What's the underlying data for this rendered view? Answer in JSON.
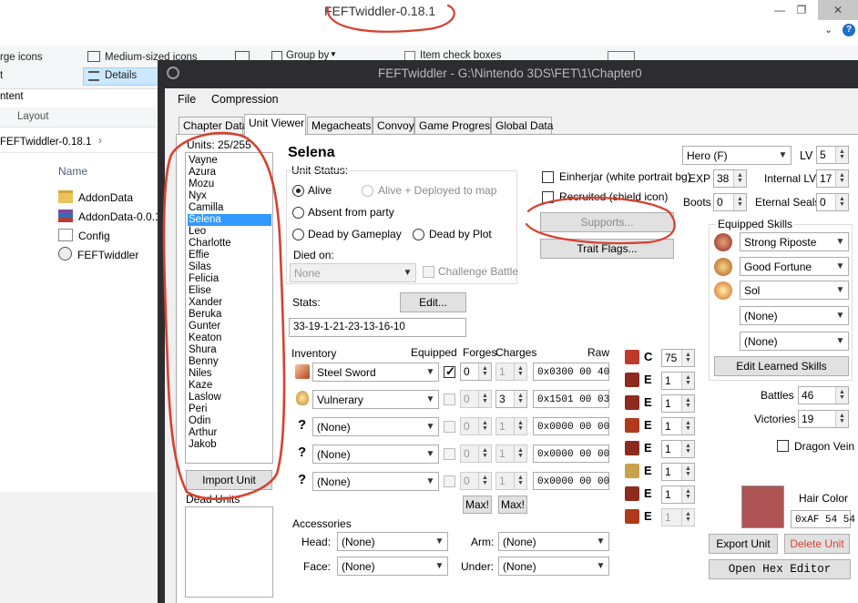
{
  "explorer": {
    "title": "FEFTwiddler-0.18.1",
    "ribbon": {
      "large_icons": "rge icons",
      "medium_icons": "Medium-sized icons",
      "details": "Details",
      "group_by": "Group by",
      "item_check_boxes": "Item check boxes",
      "list_frag": "t",
      "content_frag": "ntent",
      "layout": "Layout"
    },
    "breadcrumb": "FEFTwiddler-0.18.1",
    "column_name": "Name",
    "files": [
      "AddonData",
      "AddonData-0.0.1",
      "Config",
      "FEFTwiddler"
    ]
  },
  "app": {
    "title": "FEFTwiddler - G:\\Nintendo 3DS\\FET\\1\\Chapter0",
    "menu": [
      "File",
      "Compression"
    ],
    "tabs": [
      "Chapter Data",
      "Unit Viewer",
      "Megacheats",
      "Convoy",
      "Game Progress",
      "Global Data"
    ],
    "active_tab": "Unit Viewer",
    "units_label": "Units: 25/255",
    "units": [
      "Vayne",
      "Azura",
      "Mozu",
      "Nyx",
      "Camilla",
      "Selena",
      "Leo",
      "Charlotte",
      "Effie",
      "Silas",
      "Felicia",
      "Elise",
      "Xander",
      "Beruka",
      "Gunter",
      "Keaton",
      "Shura",
      "Benny",
      "Niles",
      "Kaze",
      "Laslow",
      "Peri",
      "Odin",
      "Arthur",
      "Jakob"
    ],
    "selected_unit": "Selena",
    "import_unit": "Import Unit",
    "dead_units": "Dead Units",
    "unit": {
      "name": "Selena",
      "status_label": "Unit Status:",
      "status_options": [
        "Alive",
        "Alive + Deployed to map",
        "Absent from party",
        "Dead by Gameplay",
        "Dead by Plot"
      ],
      "selected_status": "Alive",
      "died_on_label": "Died on:",
      "died_on_value": "None",
      "challenge_battle": "Challenge Battle",
      "stats_label": "Stats:",
      "edit": "Edit...",
      "stats_value": "33-19-1-21-23-13-16-10",
      "einherjar": "Einherjar (white portrait bg)",
      "recruited": "Recruited (shield icon)",
      "supports": "Supports...",
      "trait_flags": "Trait Flags...",
      "class": "Hero (F)",
      "lv_label": "LV",
      "lv": "5",
      "exp_label": "EXP",
      "exp": "38",
      "internal_lv_label": "Internal LV",
      "internal_lv": "17",
      "boots_label": "Boots",
      "boots": "0",
      "eternal_seals_label": "Eternal Seals",
      "eternal_seals": "0"
    },
    "inventory": {
      "header": "Inventory",
      "equipped_header": "Equipped",
      "forges_header": "Forges",
      "charges_header": "Charges",
      "raw_header": "Raw",
      "items": [
        {
          "name": "Steel Sword",
          "equipped": true,
          "forges": "0",
          "charges": "1",
          "raw": "0x0300 00 40",
          "icon": "sword-icon"
        },
        {
          "name": "Vulnerary",
          "equipped": false,
          "forges": "0",
          "charges": "3",
          "raw": "0x1501 00 03",
          "icon": "potion-icon"
        },
        {
          "name": "(None)",
          "equipped": false,
          "forges": "0",
          "charges": "1",
          "raw": "0x0000 00 00",
          "icon": "question-icon"
        },
        {
          "name": "(None)",
          "equipped": false,
          "forges": "0",
          "charges": "1",
          "raw": "0x0000 00 00",
          "icon": "question-icon"
        },
        {
          "name": "(None)",
          "equipped": false,
          "forges": "0",
          "charges": "1",
          "raw": "0x0000 00 00",
          "icon": "question-icon"
        }
      ],
      "max1": "Max!",
      "max2": "Max!"
    },
    "weapon_ranks": [
      {
        "rank": "C",
        "value": "75",
        "icon": "sword-rank-icon",
        "color": "#c0392b"
      },
      {
        "rank": "E",
        "value": "1",
        "icon": "lance-rank-icon",
        "color": "#8e2b1f"
      },
      {
        "rank": "E",
        "value": "1",
        "icon": "axe-rank-icon",
        "color": "#8e2b1f"
      },
      {
        "rank": "E",
        "value": "1",
        "icon": "dagger-rank-icon",
        "color": "#b03a1a"
      },
      {
        "rank": "E",
        "value": "1",
        "icon": "bow-rank-icon",
        "color": "#8e2b1f"
      },
      {
        "rank": "E",
        "value": "1",
        "icon": "tome-rank-icon",
        "color": "#c9a14a"
      },
      {
        "rank": "E",
        "value": "1",
        "icon": "staff-rank-icon",
        "color": "#8e2b1f"
      },
      {
        "rank": "E",
        "value": "1",
        "icon": "stone-rank-icon",
        "color": "#b03a1a"
      }
    ],
    "accessories": {
      "label": "Accessories",
      "head_label": "Head:",
      "head": "(None)",
      "arm_label": "Arm:",
      "arm": "(None)",
      "face_label": "Face:",
      "face": "(None)",
      "under_label": "Under:",
      "under": "(None)"
    },
    "skills": {
      "label": "Equipped Skills",
      "list": [
        "Strong Riposte",
        "Good Fortune",
        "Sol",
        "(None)",
        "(None)"
      ],
      "edit_learned": "Edit Learned Skills"
    },
    "battles_label": "Battles",
    "battles": "46",
    "victories_label": "Victories",
    "victories": "19",
    "dragon_vein": "Dragon Vein",
    "hair_color_label": "Hair Color",
    "hair_color_value": "0xAF 54 54",
    "hair_color_hex": "#af5454",
    "export_unit": "Export Unit",
    "delete_unit": "Delete Unit",
    "open_hex_editor": "Open Hex Editor"
  }
}
